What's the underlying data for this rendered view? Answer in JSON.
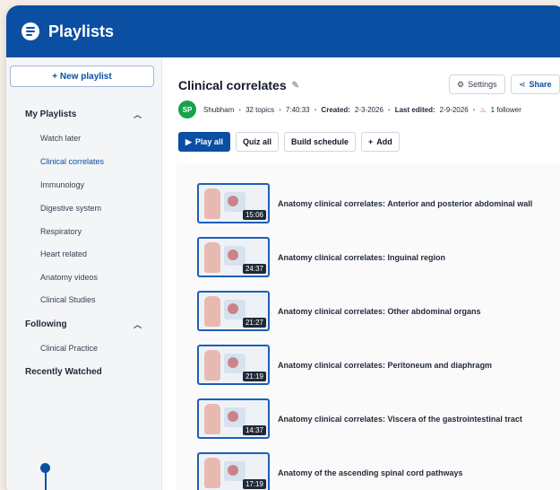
{
  "app": {
    "title": "Playlists"
  },
  "sidebar": {
    "new_playlist": "+ New playlist",
    "my_playlists": "My Playlists",
    "my_items": [
      "Watch later",
      "Clinical correlates",
      "Immunology",
      "Digestive system",
      "Respiratory",
      "Heart related",
      "Anatomy videos",
      "Clinical Studies"
    ],
    "following": "Following",
    "following_items": [
      "Clinical Practice"
    ],
    "recently_watched": "Recently Watched"
  },
  "playlist": {
    "title": "Clinical correlates",
    "settings_label": "Settings",
    "share_label": "Share",
    "avatar": "SP",
    "author": "Shubham",
    "topics": "32 topics",
    "duration": "7:40:33",
    "created_label": "Created:",
    "created": "2-3-2026",
    "edited_label": "Last edited:",
    "edited": "2-9-2026",
    "followers": "1 follower",
    "actions": {
      "play_all": "Play all",
      "quiz_all": "Quiz all",
      "build_schedule": "Build schedule",
      "add": "Add"
    },
    "videos": [
      {
        "title": "Anatomy clinical correlates: Anterior and posterior abdominal wall",
        "duration": "15:06"
      },
      {
        "title": "Anatomy clinical correlates: Inguinal region",
        "duration": "24:37"
      },
      {
        "title": "Anatomy clinical correlates: Other abdominal organs",
        "duration": "21:27"
      },
      {
        "title": "Anatomy clinical correlates: Peritoneum and diaphragm",
        "duration": "21:19"
      },
      {
        "title": "Anatomy clinical correlates: Viscera of the gastrointestinal tract",
        "duration": "14:37"
      },
      {
        "title": "Anatomy of the ascending spinal cord pathways",
        "duration": "17:19"
      }
    ]
  },
  "colors": {
    "brand": "#0b4fa3",
    "avatar": "#16a34a"
  }
}
